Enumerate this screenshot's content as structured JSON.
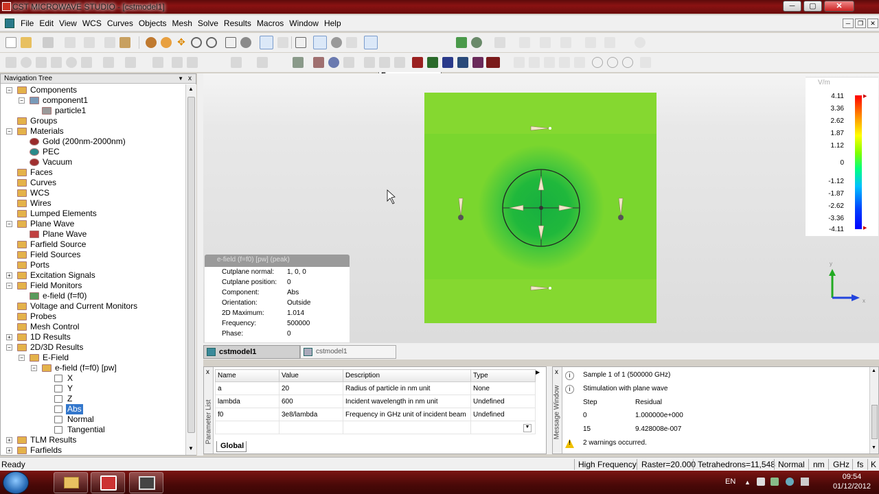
{
  "window": {
    "title": "CST MICROWAVE STUDIO - [cstmodel1]"
  },
  "menu": [
    "File",
    "Edit",
    "View",
    "WCS",
    "Curves",
    "Objects",
    "Mesh",
    "Solve",
    "Results",
    "Macros",
    "Window",
    "Help"
  ],
  "toolbar": {
    "mode_select": "Free"
  },
  "nav": {
    "title": "Navigation Tree",
    "pin": "▼",
    "close": "x",
    "items": [
      {
        "label": "Components"
      },
      {
        "label": "component1"
      },
      {
        "label": "particle1"
      },
      {
        "label": "Groups"
      },
      {
        "label": "Materials"
      },
      {
        "label": "Gold (200nm-2000nm)"
      },
      {
        "label": "PEC"
      },
      {
        "label": "Vacuum"
      },
      {
        "label": "Faces"
      },
      {
        "label": "Curves"
      },
      {
        "label": "WCS"
      },
      {
        "label": "Wires"
      },
      {
        "label": "Lumped Elements"
      },
      {
        "label": "Plane Wave"
      },
      {
        "label": "Plane Wave"
      },
      {
        "label": "Farfield Source"
      },
      {
        "label": "Field Sources"
      },
      {
        "label": "Ports"
      },
      {
        "label": "Excitation Signals"
      },
      {
        "label": "Field Monitors"
      },
      {
        "label": "e-field (f=f0)"
      },
      {
        "label": "Voltage and Current Monitors"
      },
      {
        "label": "Probes"
      },
      {
        "label": "Mesh Control"
      },
      {
        "label": "1D Results"
      },
      {
        "label": "2D/3D Results"
      },
      {
        "label": "E-Field"
      },
      {
        "label": "e-field (f=f0) [pw]"
      },
      {
        "label": "X"
      },
      {
        "label": "Y"
      },
      {
        "label": "Z"
      },
      {
        "label": "Abs"
      },
      {
        "label": "Normal"
      },
      {
        "label": "Tangential"
      },
      {
        "label": "TLM Results"
      },
      {
        "label": "Farfields"
      }
    ]
  },
  "plot_info": {
    "header": "e-field (f=f0) [pw] (peak)",
    "rows": [
      {
        "k": "Cutplane normal:",
        "v": "1, 0, 0"
      },
      {
        "k": "Cutplane position:",
        "v": "0"
      },
      {
        "k": "Component:",
        "v": "Abs"
      },
      {
        "k": "Orientation:",
        "v": "Outside"
      },
      {
        "k": "2D Maximum:",
        "v": "1.014"
      },
      {
        "k": "Frequency:",
        "v": "500000"
      },
      {
        "k": "Phase:",
        "v": "0"
      }
    ]
  },
  "legend": {
    "unit": "V/m",
    "values": [
      "4.11",
      "3.36",
      "2.62",
      "1.87",
      "1.12",
      "0",
      "-1.12",
      "-1.87",
      "-2.62",
      "-3.36",
      "-4.11"
    ],
    "marker": "▶"
  },
  "axes": {
    "y": "y",
    "x": "x"
  },
  "tabs": [
    "cstmodel1",
    "cstmodel1"
  ],
  "params": {
    "side_label": "Parameter List",
    "close": "x",
    "columns": [
      "Name",
      "Value",
      "Description",
      "Type"
    ],
    "rows": [
      {
        "name": "a",
        "value": "20",
        "desc": "Radius of particle in nm unit",
        "type": "None"
      },
      {
        "name": "lambda",
        "value": "600",
        "desc": "Incident wavelength in nm unit",
        "type": "Undefined"
      },
      {
        "name": "f0",
        "value": "3e8/lambda",
        "desc": "Frequency in GHz unit of incident beam",
        "type": "Undefined"
      }
    ],
    "tab": "Global"
  },
  "messages": {
    "side_label": "Message Window",
    "close": "x",
    "info_glyph": "i",
    "warn_glyph": "!",
    "lines": [
      "Sample 1 of 1 (500000 GHz)",
      "Stimulation with plane wave"
    ],
    "table_header": [
      "Step",
      "Residual"
    ],
    "table_rows": [
      [
        "0",
        "1.000000e+000"
      ],
      [
        "15",
        "9.428008e-007"
      ]
    ],
    "warning": "2 warnings occurred."
  },
  "status": {
    "left": "Ready",
    "mode": "High Frequency",
    "raster": "Raster=20.000",
    "mesh": "Tetrahedrons=11,548",
    "view": "Normal",
    "units": [
      "nm",
      "GHz",
      "fs"
    ],
    "temp": "K"
  },
  "tray": {
    "lang": "EN",
    "time": "09:54",
    "date": "01/12/2012"
  },
  "colors": {
    "field_green": "#7ad62e",
    "core_green": "#18b83a",
    "title_red": "#8a1212"
  }
}
